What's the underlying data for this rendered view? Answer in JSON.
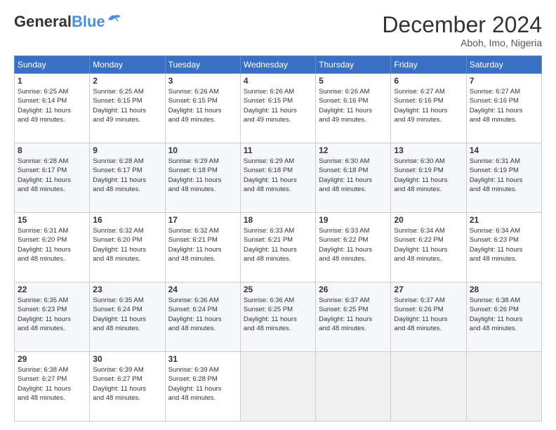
{
  "header": {
    "logo_general": "General",
    "logo_blue": "Blue",
    "month_title": "December 2024",
    "location": "Aboh, Imo, Nigeria"
  },
  "days_of_week": [
    "Sunday",
    "Monday",
    "Tuesday",
    "Wednesday",
    "Thursday",
    "Friday",
    "Saturday"
  ],
  "weeks": [
    [
      {
        "day": "1",
        "info": "Sunrise: 6:25 AM\nSunset: 6:14 PM\nDaylight: 11 hours\nand 49 minutes."
      },
      {
        "day": "2",
        "info": "Sunrise: 6:25 AM\nSunset: 6:15 PM\nDaylight: 11 hours\nand 49 minutes."
      },
      {
        "day": "3",
        "info": "Sunrise: 6:26 AM\nSunset: 6:15 PM\nDaylight: 11 hours\nand 49 minutes."
      },
      {
        "day": "4",
        "info": "Sunrise: 6:26 AM\nSunset: 6:15 PM\nDaylight: 11 hours\nand 49 minutes."
      },
      {
        "day": "5",
        "info": "Sunrise: 6:26 AM\nSunset: 6:16 PM\nDaylight: 11 hours\nand 49 minutes."
      },
      {
        "day": "6",
        "info": "Sunrise: 6:27 AM\nSunset: 6:16 PM\nDaylight: 11 hours\nand 49 minutes."
      },
      {
        "day": "7",
        "info": "Sunrise: 6:27 AM\nSunset: 6:16 PM\nDaylight: 11 hours\nand 48 minutes."
      }
    ],
    [
      {
        "day": "8",
        "info": "Sunrise: 6:28 AM\nSunset: 6:17 PM\nDaylight: 11 hours\nand 48 minutes."
      },
      {
        "day": "9",
        "info": "Sunrise: 6:28 AM\nSunset: 6:17 PM\nDaylight: 11 hours\nand 48 minutes."
      },
      {
        "day": "10",
        "info": "Sunrise: 6:29 AM\nSunset: 6:18 PM\nDaylight: 11 hours\nand 48 minutes."
      },
      {
        "day": "11",
        "info": "Sunrise: 6:29 AM\nSunset: 6:18 PM\nDaylight: 11 hours\nand 48 minutes."
      },
      {
        "day": "12",
        "info": "Sunrise: 6:30 AM\nSunset: 6:18 PM\nDaylight: 11 hours\nand 48 minutes."
      },
      {
        "day": "13",
        "info": "Sunrise: 6:30 AM\nSunset: 6:19 PM\nDaylight: 11 hours\nand 48 minutes."
      },
      {
        "day": "14",
        "info": "Sunrise: 6:31 AM\nSunset: 6:19 PM\nDaylight: 11 hours\nand 48 minutes."
      }
    ],
    [
      {
        "day": "15",
        "info": "Sunrise: 6:31 AM\nSunset: 6:20 PM\nDaylight: 11 hours\nand 48 minutes."
      },
      {
        "day": "16",
        "info": "Sunrise: 6:32 AM\nSunset: 6:20 PM\nDaylight: 11 hours\nand 48 minutes."
      },
      {
        "day": "17",
        "info": "Sunrise: 6:32 AM\nSunset: 6:21 PM\nDaylight: 11 hours\nand 48 minutes."
      },
      {
        "day": "18",
        "info": "Sunrise: 6:33 AM\nSunset: 6:21 PM\nDaylight: 11 hours\nand 48 minutes."
      },
      {
        "day": "19",
        "info": "Sunrise: 6:33 AM\nSunset: 6:22 PM\nDaylight: 11 hours\nand 48 minutes."
      },
      {
        "day": "20",
        "info": "Sunrise: 6:34 AM\nSunset: 6:22 PM\nDaylight: 11 hours\nand 48 minutes."
      },
      {
        "day": "21",
        "info": "Sunrise: 6:34 AM\nSunset: 6:23 PM\nDaylight: 11 hours\nand 48 minutes."
      }
    ],
    [
      {
        "day": "22",
        "info": "Sunrise: 6:35 AM\nSunset: 6:23 PM\nDaylight: 11 hours\nand 48 minutes."
      },
      {
        "day": "23",
        "info": "Sunrise: 6:35 AM\nSunset: 6:24 PM\nDaylight: 11 hours\nand 48 minutes."
      },
      {
        "day": "24",
        "info": "Sunrise: 6:36 AM\nSunset: 6:24 PM\nDaylight: 11 hours\nand 48 minutes."
      },
      {
        "day": "25",
        "info": "Sunrise: 6:36 AM\nSunset: 6:25 PM\nDaylight: 11 hours\nand 48 minutes."
      },
      {
        "day": "26",
        "info": "Sunrise: 6:37 AM\nSunset: 6:25 PM\nDaylight: 11 hours\nand 48 minutes."
      },
      {
        "day": "27",
        "info": "Sunrise: 6:37 AM\nSunset: 6:26 PM\nDaylight: 11 hours\nand 48 minutes."
      },
      {
        "day": "28",
        "info": "Sunrise: 6:38 AM\nSunset: 6:26 PM\nDaylight: 11 hours\nand 48 minutes."
      }
    ],
    [
      {
        "day": "29",
        "info": "Sunrise: 6:38 AM\nSunset: 6:27 PM\nDaylight: 11 hours\nand 48 minutes."
      },
      {
        "day": "30",
        "info": "Sunrise: 6:39 AM\nSunset: 6:27 PM\nDaylight: 11 hours\nand 48 minutes."
      },
      {
        "day": "31",
        "info": "Sunrise: 6:39 AM\nSunset: 6:28 PM\nDaylight: 11 hours\nand 48 minutes."
      },
      {
        "day": "",
        "info": ""
      },
      {
        "day": "",
        "info": ""
      },
      {
        "day": "",
        "info": ""
      },
      {
        "day": "",
        "info": ""
      }
    ]
  ]
}
